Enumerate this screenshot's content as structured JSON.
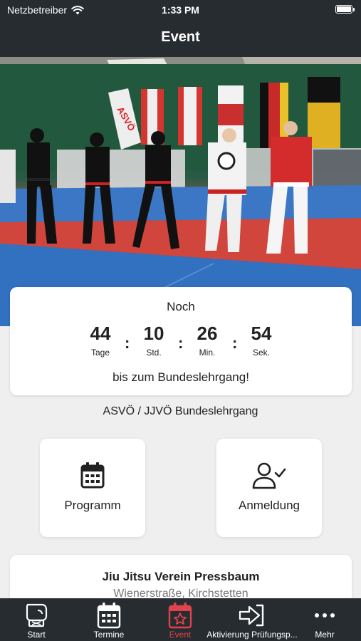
{
  "status_bar": {
    "carrier": "Netzbetreiber",
    "time": "1:33 PM"
  },
  "nav": {
    "title": "Event"
  },
  "countdown": {
    "prefix": "Noch",
    "units": [
      {
        "value": "44",
        "label": "Tage"
      },
      {
        "value": "10",
        "label": "Std."
      },
      {
        "value": "26",
        "label": "Min."
      },
      {
        "value": "54",
        "label": "Sek."
      }
    ],
    "separator": ":",
    "suffix": "bis zum Bundeslehrgang!"
  },
  "event_name": "ASVÖ / JJVÖ Bundeslehrgang",
  "tiles": [
    {
      "label": "Programm",
      "icon": "calendar-icon"
    },
    {
      "label": "Anmeldung",
      "icon": "user-check-icon"
    }
  ],
  "club": {
    "name": "Jiu Jitsu Verein Pressbaum",
    "address": "Wienerstraße, Kirchstetten"
  },
  "tabs": [
    {
      "label": "Start",
      "icon": "glove-icon",
      "active": false
    },
    {
      "label": "Termine",
      "icon": "calendar-icon",
      "active": false
    },
    {
      "label": "Event",
      "icon": "star-calendar-icon",
      "active": true
    },
    {
      "label": "Aktivierung Prüfungsp...",
      "icon": "sign-in-icon",
      "active": false
    },
    {
      "label": "Mehr",
      "icon": "more-icon",
      "active": false
    }
  ],
  "colors": {
    "bar": "#272c30",
    "accent": "#e0434e",
    "background": "#efefef"
  }
}
